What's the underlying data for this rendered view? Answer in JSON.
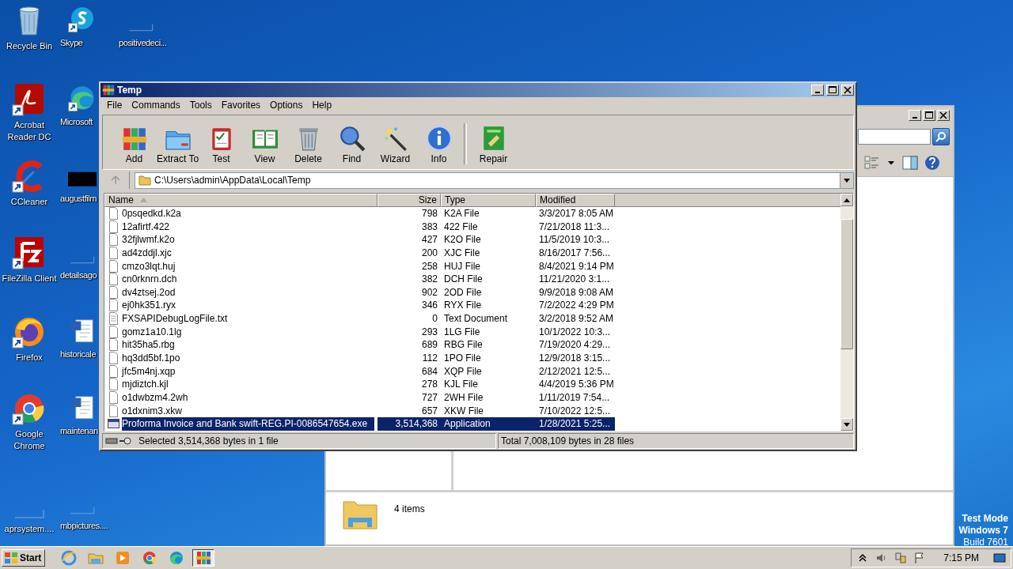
{
  "desktop_icons": [
    {
      "label": "Recycle Bin",
      "kind": "recycle",
      "shortcut": false
    },
    {
      "label": "Acrobat Reader DC",
      "kind": "acrobat",
      "shortcut": true
    },
    {
      "label": "CCleaner",
      "kind": "ccleaner",
      "shortcut": true
    },
    {
      "label": "FileZilla Client",
      "kind": "filezilla",
      "shortcut": true
    },
    {
      "label": "Firefox",
      "kind": "firefox",
      "shortcut": true
    },
    {
      "label": "Google Chrome",
      "kind": "chrome",
      "shortcut": true
    },
    {
      "label": "aprsystem....",
      "kind": "blank",
      "shortcut": false
    },
    {
      "label": "Skype",
      "kind": "skype",
      "shortcut": true
    },
    {
      "label": "Microsoft",
      "kind": "edge",
      "shortcut": true
    },
    {
      "label": "augustfilm",
      "kind": "black",
      "shortcut": false
    },
    {
      "label": "detailsago",
      "kind": "blank",
      "shortcut": false
    },
    {
      "label": "historicale",
      "kind": "word",
      "shortcut": false
    },
    {
      "label": "maintenan",
      "kind": "word",
      "shortcut": false
    },
    {
      "label": "mbpictures....",
      "kind": "blank",
      "shortcut": false
    },
    {
      "label": "positivedeci...",
      "kind": "blank",
      "shortcut": false
    }
  ],
  "os_notice": [
    {
      "text": "Test Mode",
      "bold": true
    },
    {
      "text": "Windows 7",
      "bold": true
    },
    {
      "text": "Build 7601",
      "bold": false
    }
  ],
  "explorer": {
    "status": "4 items"
  },
  "winrar": {
    "title": "Temp",
    "menu": [
      "File",
      "Commands",
      "Tools",
      "Favorites",
      "Options",
      "Help"
    ],
    "toolbar": [
      {
        "label": "Add",
        "kind": "add"
      },
      {
        "label": "Extract To",
        "kind": "extract"
      },
      {
        "label": "Test",
        "kind": "test"
      },
      {
        "label": "View",
        "kind": "view"
      },
      {
        "label": "Delete",
        "kind": "delete"
      },
      {
        "label": "Find",
        "kind": "find"
      },
      {
        "label": "Wizard",
        "kind": "wizard"
      },
      {
        "label": "Info",
        "kind": "info"
      },
      {
        "label": "Repair",
        "kind": "repair"
      }
    ],
    "path": "C:\\Users\\admin\\AppData\\Local\\Temp",
    "columns": [
      {
        "label": "Name",
        "sorted": true
      },
      {
        "label": "Size",
        "sorted": false
      },
      {
        "label": "Type",
        "sorted": false
      },
      {
        "label": "Modified",
        "sorted": false
      }
    ],
    "rows": [
      {
        "name": "0psqedkd.k2a",
        "size": "798",
        "type": "K2A File",
        "modified": "3/3/2017 8:05 AM",
        "kind": "file",
        "selected": false
      },
      {
        "name": "12afirtf.422",
        "size": "383",
        "type": "422 File",
        "modified": "7/21/2018 11:3...",
        "kind": "file",
        "selected": false
      },
      {
        "name": "32fjlwmf.k2o",
        "size": "427",
        "type": "K2O File",
        "modified": "11/5/2019 10:3...",
        "kind": "file",
        "selected": false
      },
      {
        "name": "ad4zddjl.xjc",
        "size": "200",
        "type": "XJC File",
        "modified": "8/16/2017 7:56...",
        "kind": "file",
        "selected": false
      },
      {
        "name": "cmzo3lqt.huj",
        "size": "258",
        "type": "HUJ File",
        "modified": "8/4/2021 9:14 PM",
        "kind": "file",
        "selected": false
      },
      {
        "name": "cn0rknrn.dch",
        "size": "382",
        "type": "DCH File",
        "modified": "11/21/2020 3:1...",
        "kind": "file",
        "selected": false
      },
      {
        "name": "dv4ztsej.2od",
        "size": "902",
        "type": "2OD File",
        "modified": "9/9/2018 9:08 AM",
        "kind": "file",
        "selected": false
      },
      {
        "name": "ej0hk351.ryx",
        "size": "346",
        "type": "RYX File",
        "modified": "7/2/2022 4:29 PM",
        "kind": "file",
        "selected": false
      },
      {
        "name": "FXSAPIDebugLogFile.txt",
        "size": "0",
        "type": "Text Document",
        "modified": "3/2/2018 9:52 AM",
        "kind": "text",
        "selected": false
      },
      {
        "name": "gomz1a10.1lg",
        "size": "293",
        "type": "1LG File",
        "modified": "10/1/2022 10:3...",
        "kind": "file",
        "selected": false
      },
      {
        "name": "hit35ha5.rbg",
        "size": "689",
        "type": "RBG File",
        "modified": "7/19/2020 4:29...",
        "kind": "file",
        "selected": false
      },
      {
        "name": "hq3dd5bf.1po",
        "size": "112",
        "type": "1PO File",
        "modified": "12/9/2018 3:15...",
        "kind": "file",
        "selected": false
      },
      {
        "name": "jfc5m4nj.xqp",
        "size": "684",
        "type": "XQP File",
        "modified": "2/12/2021 12:5...",
        "kind": "file",
        "selected": false
      },
      {
        "name": "mjdiztch.kjl",
        "size": "278",
        "type": "KJL File",
        "modified": "4/4/2019 5:36 PM",
        "kind": "file",
        "selected": false
      },
      {
        "name": "o1dwbzm4.2wh",
        "size": "727",
        "type": "2WH File",
        "modified": "1/11/2019 7:54...",
        "kind": "file",
        "selected": false
      },
      {
        "name": "o1dxnim3.xkw",
        "size": "657",
        "type": "XKW File",
        "modified": "7/10/2022 12:5...",
        "kind": "file",
        "selected": false
      },
      {
        "name": "Proforma Invoice and Bank swift-REG.PI-0086547654.exe",
        "size": "3,514,368",
        "type": "Application",
        "modified": "1/28/2021 5:25...",
        "kind": "exe",
        "selected": true
      }
    ],
    "status_left": "Selected 3,514,368 bytes in 1 file",
    "status_right": "Total 7,008,109 bytes in 28 files"
  },
  "taskbar": {
    "start": "Start",
    "apps": [
      {
        "kind": "ie",
        "active": false
      },
      {
        "kind": "explorer",
        "active": false
      },
      {
        "kind": "media",
        "active": false
      },
      {
        "kind": "chrome",
        "active": false
      },
      {
        "kind": "edge",
        "active": false
      },
      {
        "kind": "winrar",
        "active": true
      }
    ],
    "time": "7:15 PM"
  }
}
